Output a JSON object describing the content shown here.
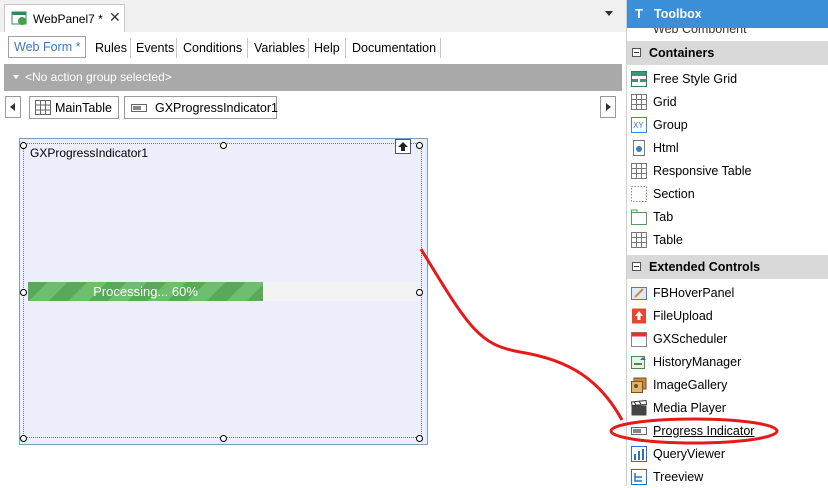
{
  "document_tab": {
    "title": "WebPanel7 *",
    "close": "✕"
  },
  "editor_tabs": [
    "Web Form *",
    "Rules",
    "Events",
    "Conditions",
    "Variables",
    "Help",
    "Documentation"
  ],
  "action_bar": {
    "text": "<No action group selected>"
  },
  "breadcrumb": [
    {
      "label": "MainTable",
      "icon": "table-icon"
    },
    {
      "label": "GXProgressIndicator1",
      "icon": "progress-indicator-icon"
    }
  ],
  "control": {
    "name": "GXProgressIndicator1",
    "progress_text": "Processing... 60%",
    "progress_value": 0.6
  },
  "toolbox": {
    "title": "Toolbox",
    "partial_item": "Web Component",
    "sections": [
      {
        "label": "Containers",
        "items": [
          {
            "label": "Free Style Grid",
            "icon": "free-style-grid-icon"
          },
          {
            "label": "Grid",
            "icon": "grid-icon"
          },
          {
            "label": "Group",
            "icon": "group-icon"
          },
          {
            "label": "Html",
            "icon": "html-icon"
          },
          {
            "label": "Responsive Table",
            "icon": "responsive-table-icon"
          },
          {
            "label": "Section",
            "icon": "section-icon"
          },
          {
            "label": "Tab",
            "icon": "tab-icon"
          },
          {
            "label": "Table",
            "icon": "table-icon"
          }
        ]
      },
      {
        "label": "Extended Controls",
        "items": [
          {
            "label": "FBHoverPanel",
            "icon": "hover-panel-icon"
          },
          {
            "label": "FileUpload",
            "icon": "file-upload-icon"
          },
          {
            "label": "GXScheduler",
            "icon": "scheduler-icon"
          },
          {
            "label": "HistoryManager",
            "icon": "history-manager-icon"
          },
          {
            "label": "ImageGallery",
            "icon": "image-gallery-icon"
          },
          {
            "label": "Media Player",
            "icon": "media-player-icon"
          },
          {
            "label": "Progress Indicator",
            "icon": "progress-indicator-icon"
          },
          {
            "label": "QueryViewer",
            "icon": "query-viewer-icon"
          },
          {
            "label": "Treeview",
            "icon": "treeview-icon"
          }
        ]
      }
    ]
  },
  "colors": {
    "accent": "#3b8fd8",
    "annotation": "#e31b1b",
    "progress": "#5aa85a"
  }
}
